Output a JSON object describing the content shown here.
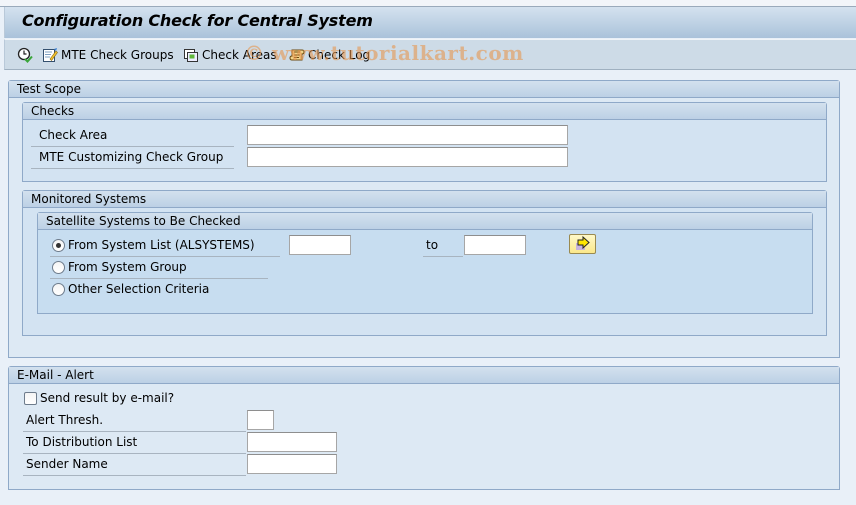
{
  "window": {
    "title": "Configuration Check for Central System"
  },
  "toolbar": {
    "items": [
      {
        "icon": "execute-clock-icon",
        "label": ""
      },
      {
        "icon": "edit-document-icon",
        "label": "MTE Check Groups"
      },
      {
        "icon": "check-areas-icon",
        "label": "Check Areas"
      },
      {
        "icon": "log-scroll-icon",
        "label": "Check Log"
      }
    ]
  },
  "watermark": "© www.tutorialkart.com",
  "test_scope": {
    "title": "Test Scope",
    "checks": {
      "title": "Checks",
      "fields": [
        {
          "label": "Check Area",
          "value": ""
        },
        {
          "label": "MTE Customizing Check Group",
          "value": ""
        }
      ]
    },
    "monitored_systems": {
      "title": "Monitored Systems",
      "satellite": {
        "title": "Satellite Systems to Be Checked",
        "options": [
          {
            "label": "From System List (ALSYSTEMS)",
            "selected": true
          },
          {
            "label": "From System Group",
            "selected": false
          },
          {
            "label": "Other Selection Criteria",
            "selected": false
          }
        ],
        "from_value": "",
        "to_label": "to",
        "to_value": "",
        "multiple_selection_icon": "arrow-right-icon"
      }
    }
  },
  "email_alert": {
    "title": "E-Mail - Alert",
    "send_checkbox": {
      "label": "Send result by e-mail?",
      "checked": false
    },
    "fields": [
      {
        "label": "Alert Thresh.",
        "value": ""
      },
      {
        "label": "To Distribution List",
        "value": ""
      },
      {
        "label": "Sender Name",
        "value": ""
      }
    ]
  },
  "colors": {
    "title_bar": "#aac2da",
    "toolbar": "#cddbe7",
    "group_border": "#8fa9c8",
    "arrow_button": "#fbe88a",
    "watermark": "#e6a060"
  }
}
